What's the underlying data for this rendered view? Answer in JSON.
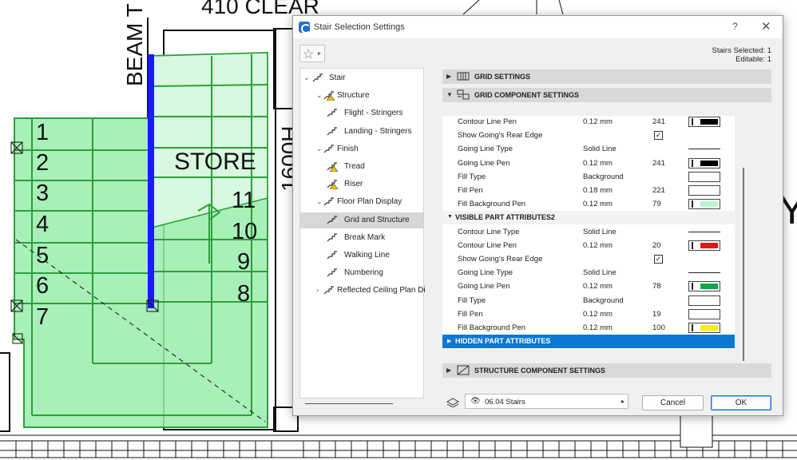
{
  "cad": {
    "labels": [
      "410 CLEAR",
      "BEAM T",
      "STORE",
      "1600H",
      "Y"
    ],
    "steps_left": [
      "1",
      "2",
      "3",
      "4",
      "5",
      "6",
      "7"
    ],
    "steps_right": [
      "11",
      "10",
      "9",
      "8"
    ]
  },
  "dialog": {
    "title": "Stair Selection Settings",
    "help_glyph": "?",
    "close_glyph": "✕",
    "selected": "Stairs Selected: 1",
    "editable": "Editable: 1"
  },
  "tree": [
    {
      "label": "Stair",
      "icon": "stair-icon",
      "toggle": "⌄",
      "level": 0
    },
    {
      "label": "Structure",
      "icon": "structure-warning-icon",
      "toggle": "⌄",
      "level": 1
    },
    {
      "label": "Flight - Stringers",
      "icon": "flight-stringers-icon",
      "toggle": "",
      "level": 2
    },
    {
      "label": "Landing - Stringers",
      "icon": "landing-stringers-icon",
      "toggle": "",
      "level": 2
    },
    {
      "label": "Finish",
      "icon": "finish-icon",
      "toggle": "⌄",
      "level": 1
    },
    {
      "label": "Tread",
      "icon": "tread-warning-icon",
      "toggle": "",
      "level": 2
    },
    {
      "label": "Riser",
      "icon": "riser-warning-icon",
      "toggle": "",
      "level": 2
    },
    {
      "label": "Floor Plan Display",
      "icon": "floor-plan-icon",
      "toggle": "⌄",
      "level": 1
    },
    {
      "label": "Grid and Structure",
      "icon": "grid-structure-icon",
      "toggle": "",
      "level": 2,
      "selected": true
    },
    {
      "label": "Break Mark",
      "icon": "break-mark-icon",
      "toggle": "",
      "level": 2
    },
    {
      "label": "Walking Line",
      "icon": "walking-line-icon",
      "toggle": "",
      "level": 2
    },
    {
      "label": "Numbering",
      "icon": "numbering-icon",
      "toggle": "",
      "level": 2
    },
    {
      "label": "Reflected Ceiling Plan Di",
      "icon": "ceiling-plan-icon",
      "toggle": "›",
      "level": 1
    }
  ],
  "sections": {
    "grid": "GRID SETTINGS",
    "grid_component": "GRID COMPONENT SETTINGS",
    "structure_component": "STRUCTURE COMPONENT SETTINGS"
  },
  "rows": [
    {
      "kind": "prop",
      "name": "Contour Line Pen",
      "val": "0.12 mm",
      "num": "241",
      "swatch": "#000000"
    },
    {
      "kind": "check",
      "name": "Show Going's Rear Edge",
      "checked": "✓"
    },
    {
      "kind": "line",
      "name": "Going Line Type",
      "val": "Solid Line"
    },
    {
      "kind": "prop",
      "name": "Going Line Pen",
      "val": "0.12 mm",
      "num": "241",
      "swatch": "#000000"
    },
    {
      "kind": "prop",
      "name": "Fill Type",
      "val": "Background",
      "num": "",
      "swatch": ""
    },
    {
      "kind": "prop",
      "name": "Fill Pen",
      "val": "0.18 mm",
      "num": "221",
      "swatch": ""
    },
    {
      "kind": "prop",
      "name": "Fill Background Pen",
      "val": "0.12 mm",
      "num": "79",
      "swatch": "#b6f5cf"
    },
    {
      "kind": "group",
      "name": "VISIBLE PART ATTRIBUTES2"
    },
    {
      "kind": "line",
      "name": "Contour Line Type",
      "val": "Solid Line"
    },
    {
      "kind": "prop",
      "name": "Contour Line Pen",
      "val": "0.12 mm",
      "num": "20",
      "swatch": "#ee1111"
    },
    {
      "kind": "check",
      "name": "Show Going's Rear Edge",
      "checked": "✓"
    },
    {
      "kind": "line",
      "name": "Going Line Type",
      "val": "Solid Line"
    },
    {
      "kind": "prop",
      "name": "Going Line Pen",
      "val": "0.12 mm",
      "num": "78",
      "swatch": "#11a84a"
    },
    {
      "kind": "prop",
      "name": "Fill Type",
      "val": "Background",
      "num": "",
      "swatch": ""
    },
    {
      "kind": "prop",
      "name": "Fill Pen",
      "val": "0.12 mm",
      "num": "19",
      "swatch": ""
    },
    {
      "kind": "prop",
      "name": "Fill Background Pen",
      "val": "0.12 mm",
      "num": "100",
      "swatch": "#ffee00"
    },
    {
      "kind": "selgroup",
      "name": "HIDDEN PART ATTRIBUTES"
    }
  ],
  "footer": {
    "layer": "06.04 Stairs",
    "cancel": "Cancel",
    "ok": "OK"
  },
  "colors": {
    "stair_fill": "#99ecac",
    "stair_stroke": "#2aa03a",
    "stringer": "#1a1aff",
    "accent": "#0a78d7"
  }
}
